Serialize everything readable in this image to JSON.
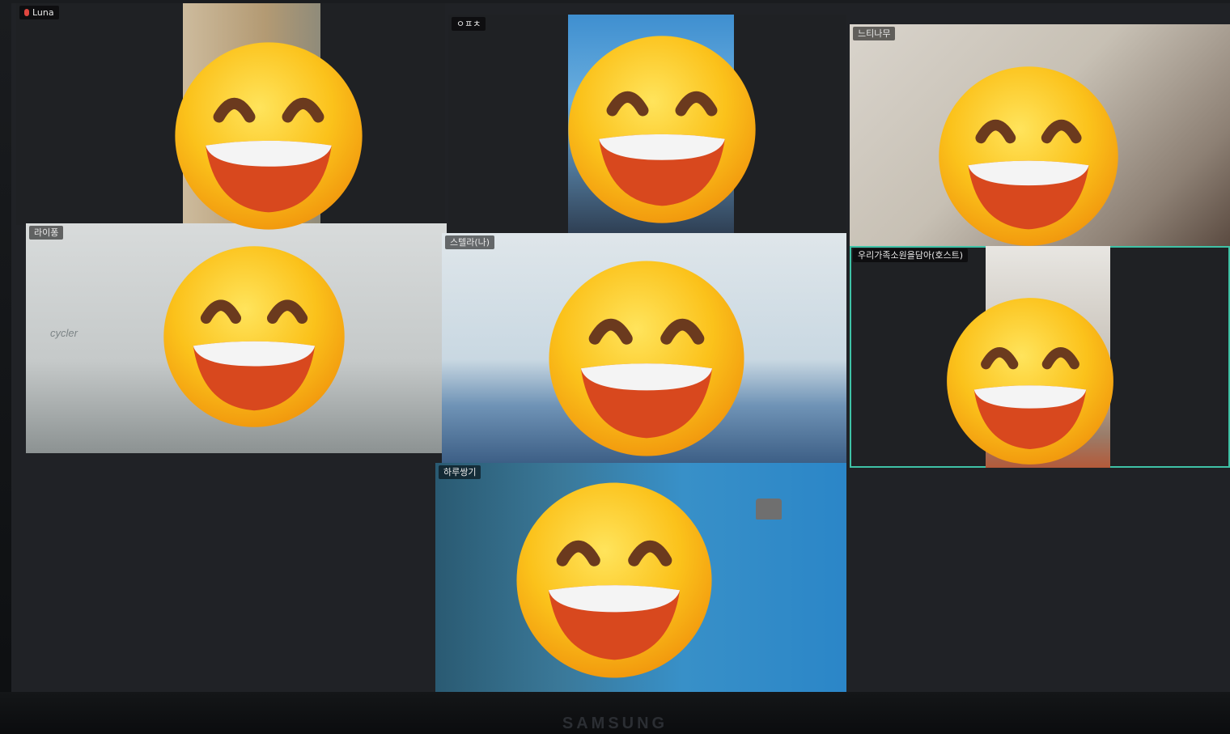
{
  "app": {
    "brand": "SAMSUNG"
  },
  "colors": {
    "active_speaker": "#3fc2a6",
    "tile_bg": "#1f2124",
    "name_bg": "rgba(0,0,0,0.55)"
  },
  "participants": [
    {
      "name": "Luna",
      "muted": true
    },
    {
      "name": "ㅇㅍㅊ"
    },
    {
      "name": "느티나무"
    },
    {
      "name": "라이퐁",
      "wall_text": "cycler"
    },
    {
      "name": "스텔라(나)"
    },
    {
      "name": "우리가족소원을담아(호스트)",
      "active": true
    },
    {
      "name": "하루쌍기"
    }
  ],
  "overlay_icon": "grinning-face-emoji"
}
